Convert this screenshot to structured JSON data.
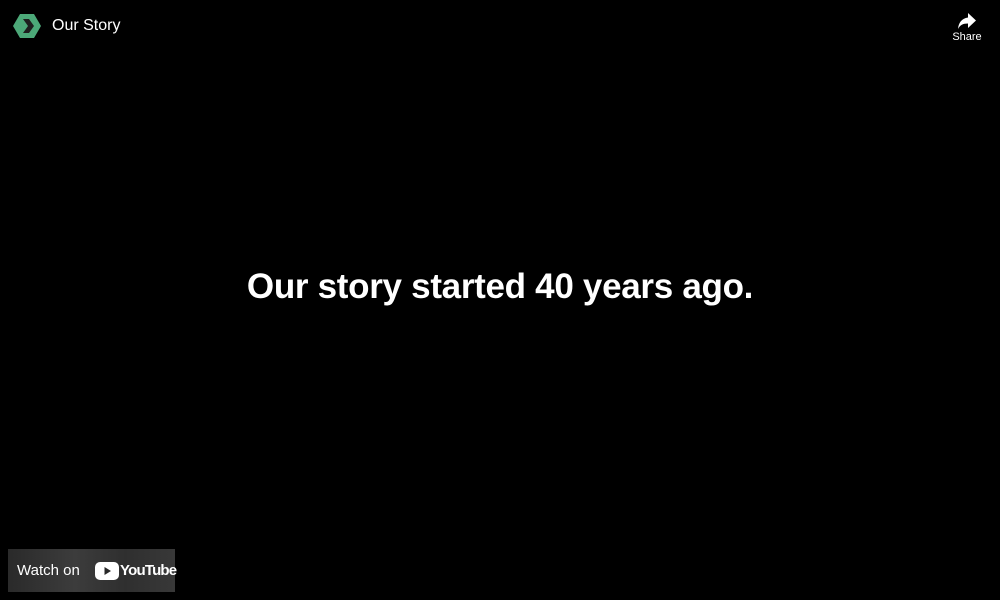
{
  "header": {
    "title": "Our Story",
    "channel_logo": "chevron-hexagon-logo",
    "share_label": "Share",
    "share_icon": "share-arrow-icon"
  },
  "video": {
    "frame_text": "Our story started 40 years ago."
  },
  "footer": {
    "watch_on_label": "Watch on",
    "brand_logo": "youtube-logo",
    "brand_wordmark": "YouTube"
  },
  "colors": {
    "background": "#000000",
    "logo_green": "#4ca878",
    "logo_dark": "#1e1e1e",
    "text": "#ffffff"
  }
}
